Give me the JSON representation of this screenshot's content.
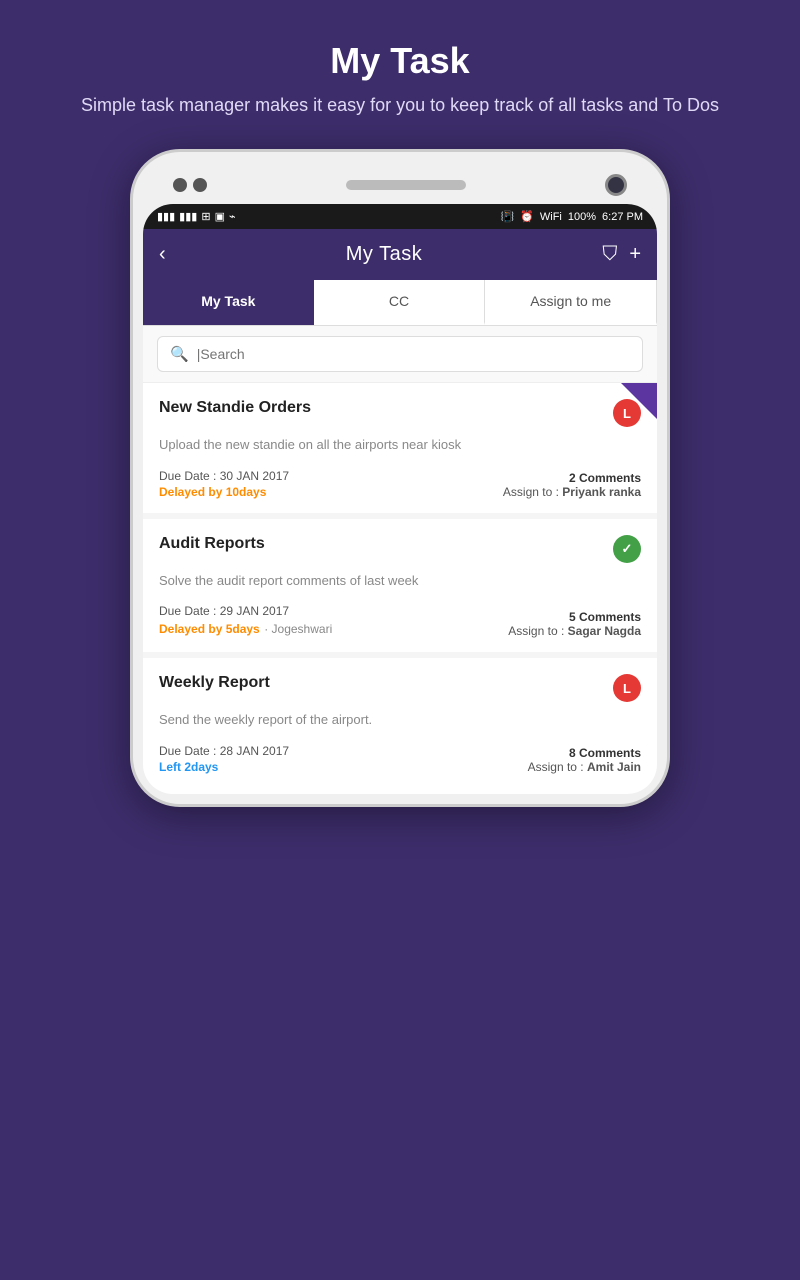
{
  "page": {
    "title": "My Task",
    "subtitle": "Simple task manager makes it easy for you to keep track of all tasks and To Dos"
  },
  "status_bar": {
    "time": "6:27 PM",
    "battery": "100%",
    "signal": "signal"
  },
  "app_bar": {
    "title": "My Task",
    "back_label": "‹",
    "filter_icon": "⛉",
    "add_icon": "+"
  },
  "tabs": [
    {
      "label": "My Task",
      "active": true
    },
    {
      "label": "CC",
      "active": false
    },
    {
      "label": "Assign to me",
      "active": false
    }
  ],
  "search": {
    "placeholder": "|Search"
  },
  "tasks": [
    {
      "id": "task-1",
      "title": "New Standie Orders",
      "description": "Upload the new standie on all the airports near kiosk",
      "due_date_label": "Due Date : 30 JAN 2017",
      "status": "Delayed by 10days",
      "status_type": "delayed",
      "comments": "2 Comments",
      "assign_to_label": "Assign to :",
      "assignee": "Priyank ranka",
      "badge": "L",
      "badge_type": "red",
      "has_ribbon": true,
      "extra_info": ""
    },
    {
      "id": "task-2",
      "title": "Audit Reports",
      "description": "Solve the audit report comments of last week",
      "due_date_label": "Due Date : 29 JAN 2017",
      "status": "Delayed by 5days",
      "status_type": "delayed",
      "comments": "5 Comments",
      "assign_to_label": "Assign to :",
      "assignee": "Sagar Nagda",
      "badge": "✓",
      "badge_type": "green",
      "has_ribbon": false,
      "extra_info": "Jogeshwari"
    },
    {
      "id": "task-3",
      "title": "Weekly Report",
      "description": "Send the weekly report of the airport.",
      "due_date_label": "Due Date : 28 JAN 2017",
      "status": "Left 2days",
      "status_type": "left",
      "comments": "8 Comments",
      "assign_to_label": "Assign to :",
      "assignee": "Amit Jain",
      "badge": "L",
      "badge_type": "red",
      "has_ribbon": false,
      "extra_info": ""
    }
  ]
}
